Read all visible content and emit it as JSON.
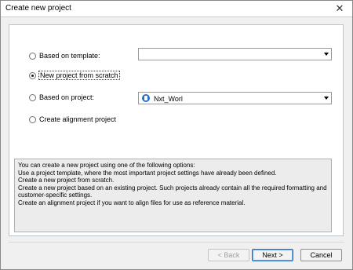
{
  "window": {
    "title": "Create new project",
    "close_glyph": "✕"
  },
  "options": {
    "template": {
      "label": "Based on template:",
      "checked": false,
      "value": ""
    },
    "scratch": {
      "label": "New project from scratch",
      "checked": true
    },
    "project": {
      "label": "Based on project:",
      "checked": false,
      "value": "Nxt_Worl"
    },
    "alignment": {
      "label": "Create alignment project",
      "checked": false
    }
  },
  "description": [
    "You can create a new project using one of the following options:",
    "Use a project template, where the most important project settings have already been defined.",
    "Create a new project from scratch.",
    "Create a new project based on an existing project. Such projects already contain all the required formatting and",
    "customer-specific settings.",
    "Create an alignment project if you want to align files for use as reference material."
  ],
  "buttons": {
    "back": "< Back",
    "next": "Next >",
    "cancel": "Cancel"
  },
  "icons": {
    "project": "project-icon",
    "dropdown": "chevron-down-icon",
    "close": "close-icon"
  }
}
